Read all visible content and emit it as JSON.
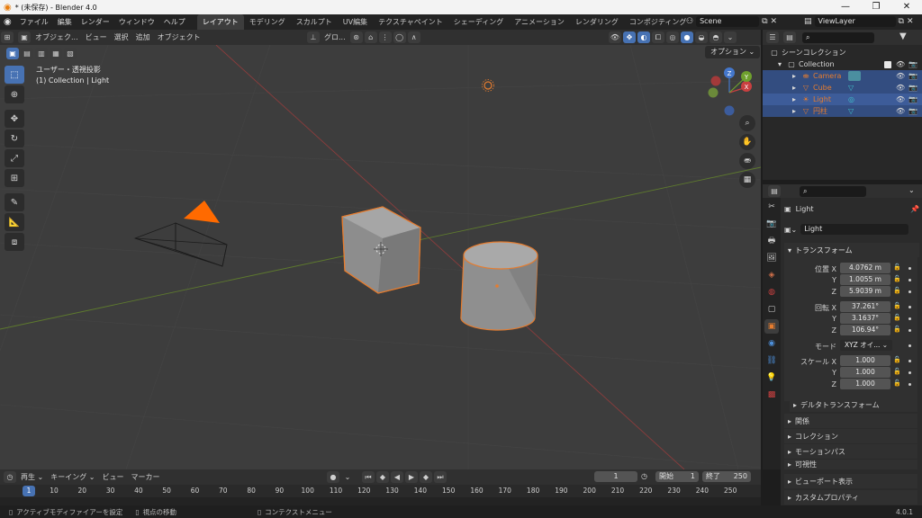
{
  "window": {
    "title": "* (未保存) - Blender 4.0",
    "controls": [
      "—",
      "❐",
      "✕"
    ]
  },
  "menus": [
    "ファイル",
    "編集",
    "レンダー",
    "ウィンドウ",
    "ヘルプ"
  ],
  "workspaces": [
    "レイアウト",
    "モデリング",
    "スカルプト",
    "UV編集",
    "テクスチャペイント",
    "シェーディング",
    "アニメーション",
    "レンダリング",
    "コンポジティング"
  ],
  "scene": "Scene",
  "view_layer": "ViewLayer",
  "viewport_header": {
    "mode": "オブジェク...",
    "menus": [
      "ビュー",
      "選択",
      "追加",
      "オブジェクト"
    ],
    "transform": "グロ...",
    "options_label": "オプション"
  },
  "viewport_overlay": {
    "line1": "ユーザー・透視投影",
    "line2": "(1) Collection | Light"
  },
  "gizmo": {
    "x": "X",
    "y": "Y",
    "z": "Z"
  },
  "outliner": {
    "root": "シーンコレクション",
    "collection": "Collection",
    "items": [
      {
        "name": "Camera",
        "color": "#e57c2f"
      },
      {
        "name": "Cube",
        "color": "#e57c2f"
      },
      {
        "name": "Light",
        "color": "#e57c2f"
      },
      {
        "name": "円柱",
        "color": "#e57c2f"
      }
    ]
  },
  "properties": {
    "object_name": "Light",
    "object_field": "Light",
    "transform_title": "トランスフォーム",
    "location_label": "位置 X",
    "rotation_label": "回転 X",
    "scale_label": "スケール X",
    "axis_y": "Y",
    "axis_z": "Z",
    "location": [
      "4.0762 m",
      "1.0055 m",
      "5.9039 m"
    ],
    "rotation": [
      "37.261°",
      "3.1637°",
      "106.94°"
    ],
    "mode_label": "モード",
    "mode_value": "XYZ オイ...",
    "scale": [
      "1.000",
      "1.000",
      "1.000"
    ],
    "delta": "デルタトランスフォーム",
    "sections": [
      "関係",
      "コレクション",
      "モーションパス",
      "可視性",
      "ビューポート表示",
      "カスタムプロパティ"
    ]
  },
  "timeline": {
    "menus": [
      "再生",
      "キーイング",
      "ビュー",
      "マーカー"
    ],
    "current_frame": "1",
    "start_label": "開始",
    "start": "1",
    "end_label": "終了",
    "end": "250",
    "ruler": [
      "1",
      "10",
      "20",
      "30",
      "40",
      "50",
      "60",
      "70",
      "80",
      "90",
      "100",
      "110",
      "120",
      "130",
      "140",
      "150",
      "160",
      "170",
      "180",
      "190",
      "200",
      "210",
      "220",
      "230",
      "240",
      "250"
    ]
  },
  "status": {
    "left": "アクティブモディファイアーを設定",
    "middle": "視点の移動",
    "right": "コンテクストメニュー",
    "version": "4.0.1"
  },
  "colors": {
    "accent": "#4772b3",
    "selection": "#e57c2f",
    "x_axis": "#c94040",
    "y_axis": "#6fa02d"
  }
}
